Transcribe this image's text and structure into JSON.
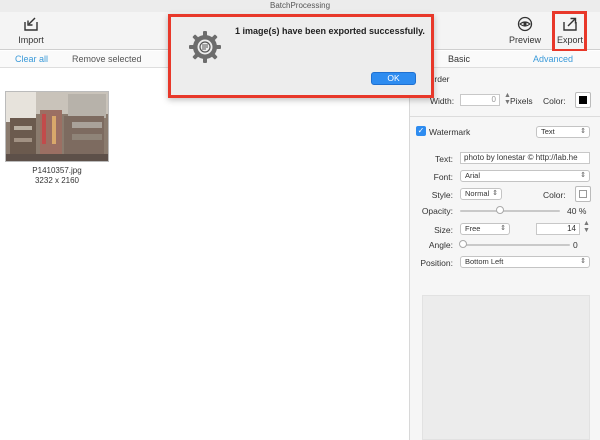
{
  "window": {
    "title": "BatchProcessing"
  },
  "toolbar": {
    "import_label": "Import",
    "preview_label": "Preview",
    "export_label": "Export",
    "import_icon": "import-icon",
    "preview_icon": "eye-icon",
    "export_icon": "export-icon"
  },
  "subbar": {
    "clear_all": "Clear all",
    "remove_selected": "Remove selected",
    "tab_basic": "Basic",
    "tab_advanced": "Advanced"
  },
  "images": [
    {
      "filename": "P1410357.jpg",
      "dimensions": "3232 x 2160"
    }
  ],
  "border": {
    "section_label": "Border",
    "width_label": "Width:",
    "width_value": "0",
    "units_label": "Pixels",
    "color_label": "Color:",
    "color_value": "#000000"
  },
  "watermark": {
    "enabled": true,
    "label": "Watermark",
    "type_value": "Text",
    "text_label": "Text:",
    "text_value": "photo by lonestar © http://lab.he",
    "font_label": "Font:",
    "font_value": "Arial",
    "style_label": "Style:",
    "style_value": "Normal",
    "color_label": "Color:",
    "opacity_label": "Opacity:",
    "opacity_value": "40 %",
    "opacity_fraction": 0.4,
    "size_label": "Size:",
    "size_mode": "Free",
    "size_value": "14",
    "angle_label": "Angle:",
    "angle_value": "0",
    "position_label": "Position:",
    "position_value": "Bottom Left"
  },
  "dialog": {
    "message": "1 image(s) have been exported successfully.",
    "ok_label": "OK"
  },
  "colors": {
    "accent": "#2e8cf0",
    "highlight": "#e8382a",
    "link": "#3a9ad9"
  }
}
